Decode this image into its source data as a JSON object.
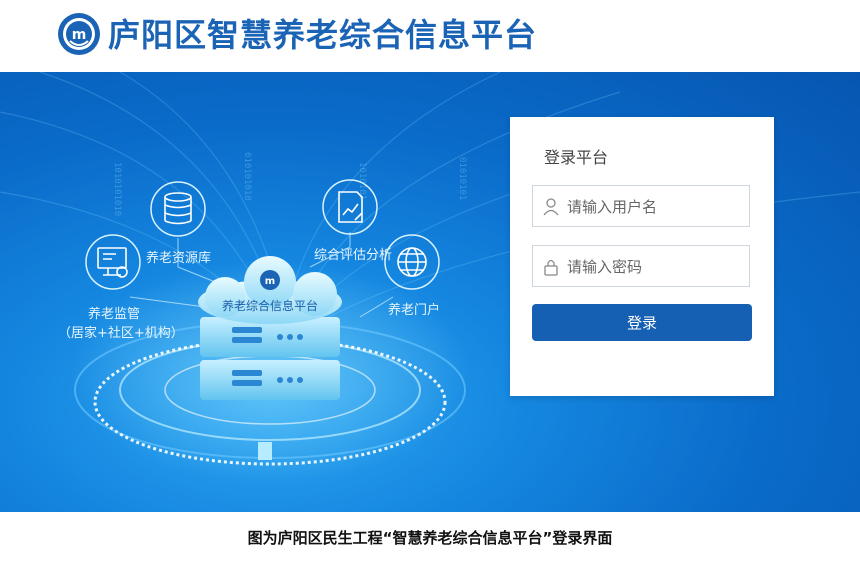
{
  "header": {
    "title": "庐阳区智慧养老综合信息平台",
    "logo_text": "m"
  },
  "banner": {
    "center_label": "养老综合信息平台",
    "features": [
      {
        "label": "养老资源库",
        "icon": "database-icon"
      },
      {
        "label": "综合评估分析",
        "icon": "chart-doc-icon"
      },
      {
        "label": "养老门户",
        "icon": "globe-icon"
      },
      {
        "label": "养老监管",
        "icon": "monitor-icon"
      }
    ],
    "monitor_sub": "（居家+社区+机构）"
  },
  "login": {
    "title": "登录平台",
    "username_placeholder": "请输入用户名",
    "password_placeholder": "请输入密码",
    "submit_label": "登录"
  },
  "caption": "图为庐阳区民生工程“智慧养老综合信息平台”登录界面",
  "colors": {
    "brand": "#1b63b4",
    "button": "#1560b2",
    "banner": "#0a6bc9"
  }
}
